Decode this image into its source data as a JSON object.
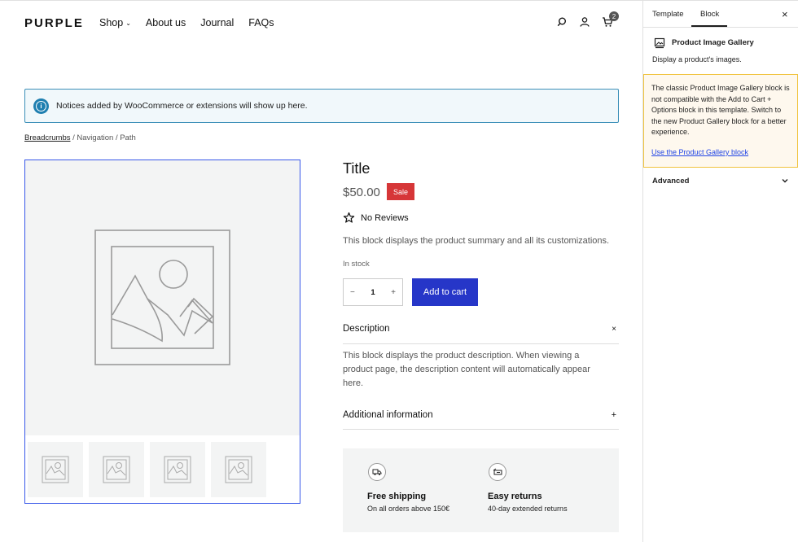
{
  "header": {
    "logo": "PURPLE",
    "nav": [
      "Shop",
      "About us",
      "Journal",
      "FAQs"
    ],
    "cart_count": "2"
  },
  "notice": {
    "text": "Notices added by WooCommerce or extensions will show up here."
  },
  "breadcrumbs": {
    "link": "Breadcrumbs",
    "rest": " / Navigation / Path"
  },
  "product": {
    "title": "Title",
    "price": "$50.00",
    "sale_badge": "Sale",
    "reviews": "No Reviews",
    "summary": "This block displays the product summary and all its customizations.",
    "stock": "In stock",
    "quantity": "1",
    "qty_minus": "−",
    "qty_plus": "+",
    "add_to_cart": "Add to cart",
    "accordion": [
      {
        "label": "Description",
        "toggle": "×"
      },
      {
        "label": "Additional information",
        "toggle": "+"
      }
    ],
    "description": "This block displays the product description. When viewing a product page, the description content will automatically appear here."
  },
  "features": [
    {
      "icon": "truck-icon",
      "title": "Free shipping",
      "subtitle": "On all orders above 150€"
    },
    {
      "icon": "return-box-icon",
      "title": "Easy returns",
      "subtitle": "40-day extended returns"
    }
  ],
  "sidebar": {
    "tabs": [
      "Template",
      "Block"
    ],
    "active_tab": "Block",
    "block_title": "Product Image Gallery",
    "block_desc": "Display a product's images.",
    "warning": "The classic Product Image Gallery block is not compatible with the Add to Cart + Options block in this template. Switch to the new Product Gallery block for a better experience.",
    "warning_link": "Use the Product Gallery block",
    "advanced": "Advanced"
  },
  "colors": {
    "accent": "#3858e9",
    "add_to_cart": "#2636c8",
    "sale": "#d63638",
    "notice_border": "#3b8fb8",
    "warning_bg": "#fef8ee",
    "warning_border": "#f0c33c"
  }
}
